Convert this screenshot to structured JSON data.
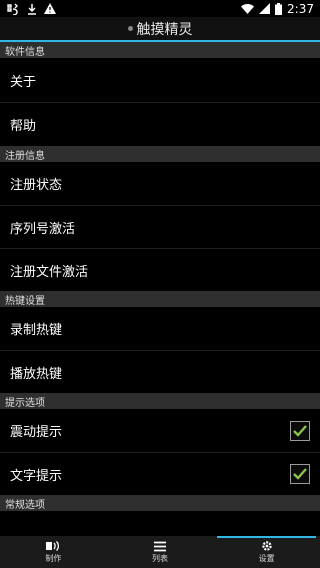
{
  "status_bar": {
    "time": "2:37",
    "icons": [
      "bug-icon",
      "download-icon",
      "warning-icon",
      "wifi-icon",
      "signal-icon",
      "battery-icon"
    ]
  },
  "app": {
    "title": "触摸精灵"
  },
  "sections": {
    "software": {
      "header": "软件信息",
      "items": [
        "关于",
        "帮助"
      ]
    },
    "registration": {
      "header": "注册信息",
      "items": [
        "注册状态",
        "序列号激活",
        "注册文件激活"
      ]
    },
    "hotkeys": {
      "header": "热键设置",
      "items": [
        "录制热键",
        "播放热键"
      ]
    },
    "notifications": {
      "header": "提示选项",
      "items": [
        "震动提示",
        "文字提示"
      ],
      "checked": [
        true,
        true
      ]
    },
    "general": {
      "header": "常规选项"
    }
  },
  "bottom_nav": {
    "items": [
      {
        "label": "制作",
        "icon": "record-icon",
        "active": false
      },
      {
        "label": "列表",
        "icon": "list-icon",
        "active": false
      },
      {
        "label": "设置",
        "icon": "gear-icon",
        "active": true
      }
    ]
  },
  "colors": {
    "accent": "#33b5e5",
    "check": "#8bc34a",
    "section_bg": "#2f2f2f",
    "bg": "#000000"
  }
}
